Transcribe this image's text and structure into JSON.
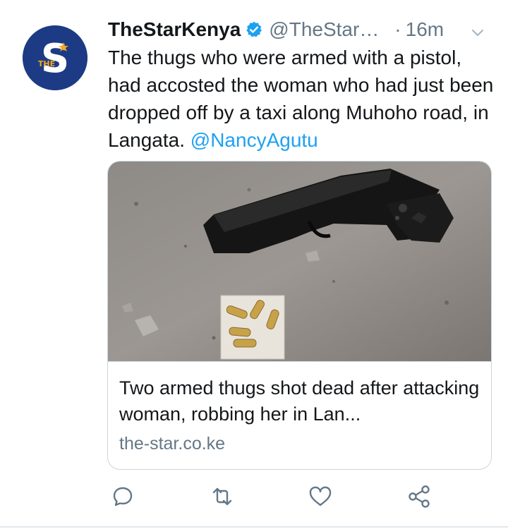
{
  "tweet": {
    "display_name": "TheStarKenya",
    "handle": "@TheStarK...",
    "separator": "·",
    "time": "16m",
    "text": "The thugs who were armed with a pistol, had accosted the woman who had just been dropped off by a taxi along Muhoho road, in Langata. ",
    "mention": "@NancyAgutu"
  },
  "avatar": {
    "logo_letter": "S",
    "logo_small": "THE"
  },
  "card": {
    "title": "Two armed thugs shot dead after attacking woman, robbing her in Lan...",
    "domain": "the-star.co.ke"
  },
  "icons": {
    "verified": "verified-badge-icon",
    "caret": "chevron-down-icon",
    "reply": "reply-icon",
    "retweet": "retweet-icon",
    "like": "heart-icon",
    "share": "share-icon"
  },
  "colors": {
    "accent": "#1da1f2",
    "muted": "#657786",
    "avatar_bg": "#1d3b84"
  }
}
